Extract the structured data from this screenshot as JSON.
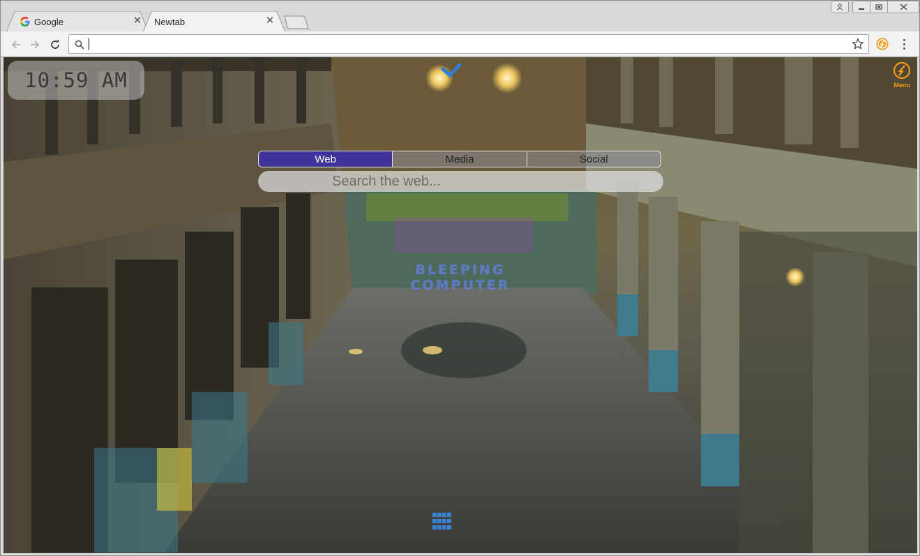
{
  "tabs": [
    {
      "label": "Google",
      "active": false,
      "icon": "google-g-icon"
    },
    {
      "label": "Newtab",
      "active": true
    }
  ],
  "toolbar": {
    "address_value": "",
    "address_placeholder": ""
  },
  "newtab": {
    "clock": "10:59 AM",
    "menu_label": "Menu",
    "search_tabs": [
      {
        "label": "Web",
        "active": true
      },
      {
        "label": "Media",
        "active": false
      },
      {
        "label": "Social",
        "active": false
      }
    ],
    "search_placeholder": "Search the web...",
    "watermark_lines": [
      "BLEEPING",
      "COMPUTER"
    ]
  },
  "colors": {
    "accent_orange": "#f29a1e",
    "active_search_tab": "#3228a0",
    "apps_blue": "#3b82d6"
  }
}
